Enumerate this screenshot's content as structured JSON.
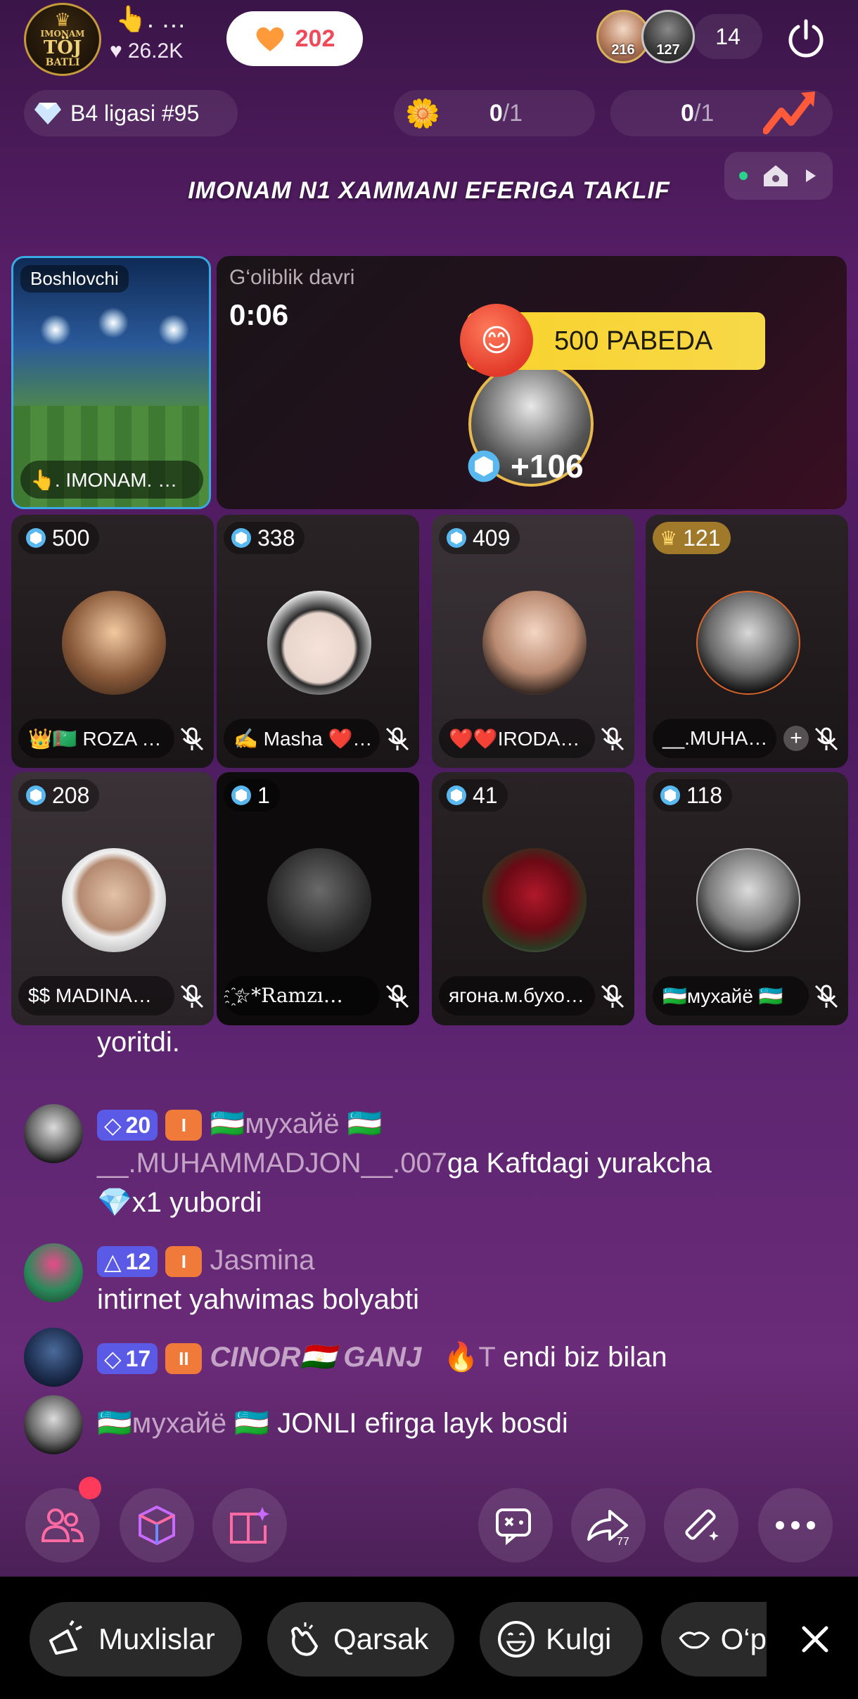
{
  "topbar": {
    "host_avatar_text": [
      "IMONAM",
      "TÖJ",
      "BATLI"
    ],
    "host_name": "👆. …",
    "host_likes": "26.2K",
    "follow_count": "202",
    "viewers": [
      {
        "badge": "216"
      },
      {
        "badge": "127"
      }
    ],
    "viewer_count": "14"
  },
  "league": {
    "label": "B4 ligasi #95",
    "goal_1": {
      "current": "0",
      "total": "/1"
    },
    "goal_2": {
      "current": "0",
      "total": "/1"
    }
  },
  "stream_title": "IMONAM N1 XAMMANI EFERIGA TAKLIF",
  "host_tile": {
    "label": "Boshlovchi",
    "name": "👆.    IMONAM. …"
  },
  "battle": {
    "period_label": "G‘oliblik davri",
    "timer": "0:06",
    "banner": "500 PABEDA",
    "score": "+106"
  },
  "seats": [
    {
      "score": "500",
      "name": "👑🇹🇲 ROZA …",
      "badge": "diamond"
    },
    {
      "score": "338",
      "name": "✍️ Masha ❤️…",
      "badge": "diamond"
    },
    {
      "score": "409",
      "name": "❤️❤️IRODA…",
      "badge": "diamond"
    },
    {
      "score": "121",
      "name": "__.MUHA…",
      "badge": "crown"
    },
    {
      "score": "208",
      "name": "$$ MADINA…",
      "badge": "diamond"
    },
    {
      "score": "1",
      "name": "҈☆*Ramzı…",
      "badge": "diamond"
    },
    {
      "score": "41",
      "name": "ягона.м.бухо…",
      "badge": "diamond"
    },
    {
      "score": "118",
      "name": "🇺🇿мухайё 🇺🇿",
      "badge": "diamond"
    }
  ],
  "chat": {
    "partial_top": "yoritdi.",
    "messages": [
      {
        "level": "20",
        "fan_level": "I",
        "user": "🇺🇿мухайё 🇺🇿",
        "line2_user": "__.MUHAMMADJON__.007",
        "line2_text": "ga Kaftdagi yurakcha",
        "line3": "💎x1 yubordi"
      },
      {
        "level": "12",
        "fan_level": "I",
        "user": "Jasmina",
        "line2": "intirnet yahwimas bolyabti"
      },
      {
        "level": "17",
        "fan_level": "II",
        "user": "CINOR🇹🇯 GANJ",
        "user_suffix": "🔥T",
        "text": "endi biz bilan"
      },
      {
        "user": "🇺🇿мухайё 🇺🇿",
        "text": "JONLI efirga layk bosdi"
      }
    ]
  },
  "quick_reactions": [
    "Muxlislar",
    "Qarsak",
    "Kulgi",
    "O‘p"
  ],
  "colors": {
    "accent_orange": "#f07a3a",
    "level_blue": "#5a5ae6",
    "host_border": "#3aa9e2",
    "gold": "#e7b84a",
    "banner_yellow": "#f9d22b"
  }
}
